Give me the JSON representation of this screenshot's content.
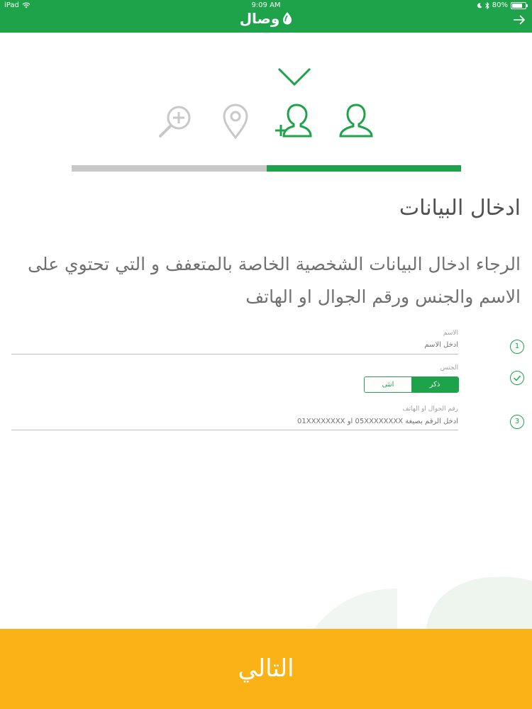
{
  "status": {
    "device": "iPad",
    "time": "9:09 AM",
    "battery": "80%",
    "battery_level": 0.8
  },
  "nav": {
    "logo_text": "وصال"
  },
  "progress": {
    "fraction": 0.5
  },
  "content": {
    "heading": "ادخال البيانات",
    "description": "الرجاء ادخال البيانات الشخصية الخاصة بالمتعفف و التي تحتوي على الاسم والجنس ورقم الجوال او الهاتف"
  },
  "form": {
    "name": {
      "label": "الاسم",
      "placeholder": "ادخل الاسم",
      "step": "1"
    },
    "gender": {
      "label": "الجنس",
      "options": [
        "ذكر",
        "انثى"
      ],
      "selected": "ذكر",
      "step_icon": "checkmark-icon"
    },
    "phone": {
      "label": "رقم الجوال او الهاتف",
      "placeholder": "أدخل الرقم بصيغة 05XXXXXXXX أو 01XXXXXXXX",
      "step": "3"
    }
  },
  "footer": {
    "next_label": "التالي"
  },
  "colors": {
    "primary": "#1ea34a",
    "accent": "#fbb216",
    "inactive": "#c8c8c8"
  }
}
